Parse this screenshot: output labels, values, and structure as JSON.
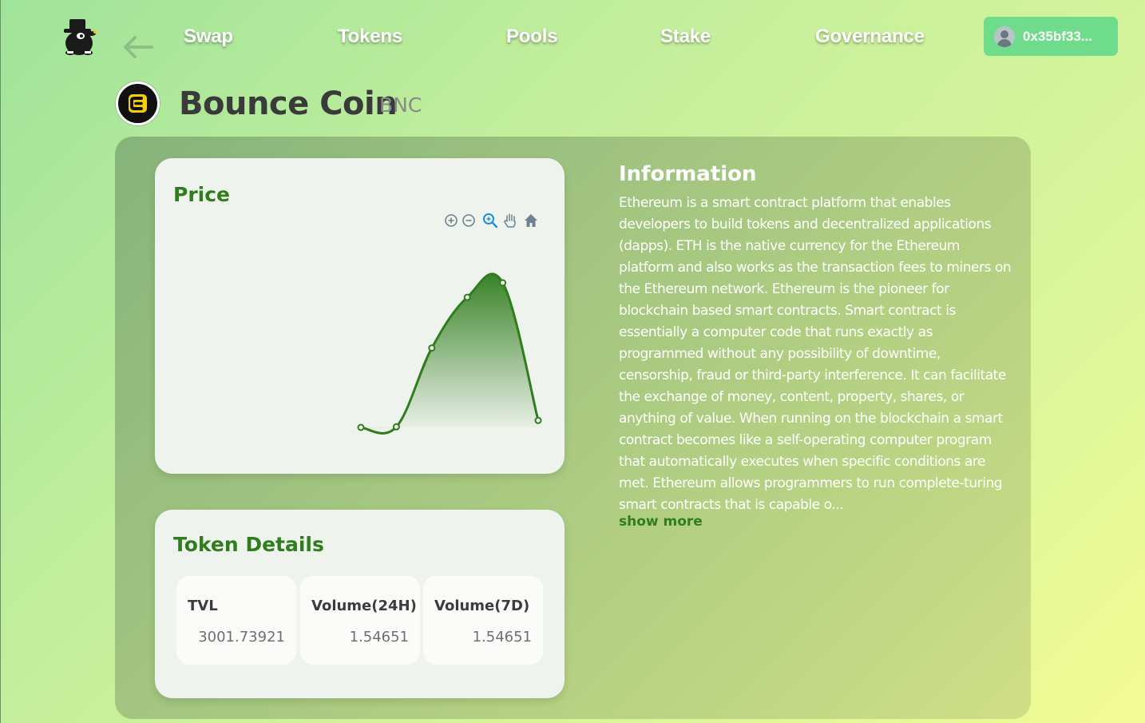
{
  "nav": {
    "links": [
      "Swap",
      "Tokens",
      "Pools",
      "Stake",
      "Governance"
    ],
    "wallet_address": "0x35bf33..."
  },
  "token": {
    "name": "Bounce Coin",
    "symbol": "BNC"
  },
  "price_card": {
    "title": "Price",
    "toolbar_icons": [
      "zoom-in-icon",
      "zoom-out-icon",
      "magnifier-icon",
      "pan-hand-icon",
      "home-icon"
    ]
  },
  "chart_data": {
    "type": "area",
    "title": "Price",
    "values": [
      0.2,
      0.6,
      55,
      90,
      100,
      5
    ],
    "color": "#2f7d1d"
  },
  "details_card": {
    "title": "Token Details",
    "stats": [
      {
        "label": "TVL",
        "value": "3001.73921"
      },
      {
        "label": "Volume(24H)",
        "value": "1.54651"
      },
      {
        "label": "Volume(7D)",
        "value": "1.54651"
      }
    ]
  },
  "info": {
    "title": "Information",
    "text": "Ethereum is a smart contract platform that enables developers to build tokens and decentralized applications (dapps). ETH is the native currency for the Ethereum platform and also works as the transaction fees to miners on the Ethereum network. Ethereum is the pioneer for blockchain based smart contracts. Smart contract is essentially a computer code that runs exactly as programmed without any possibility of downtime, censorship, fraud or third-party interference. It can facilitate the exchange of money, content, property, shares, or anything of value. When running on the blockchain a smart contract becomes like a self-operating computer program that automatically executes when specific conditions are met. Ethereum allows programmers to run complete-turing smart contracts that is capable o...",
    "show_more": "show more"
  },
  "colors": {
    "accent_green": "#2f7d1d",
    "wallet_bg": "#6fdc8c"
  }
}
